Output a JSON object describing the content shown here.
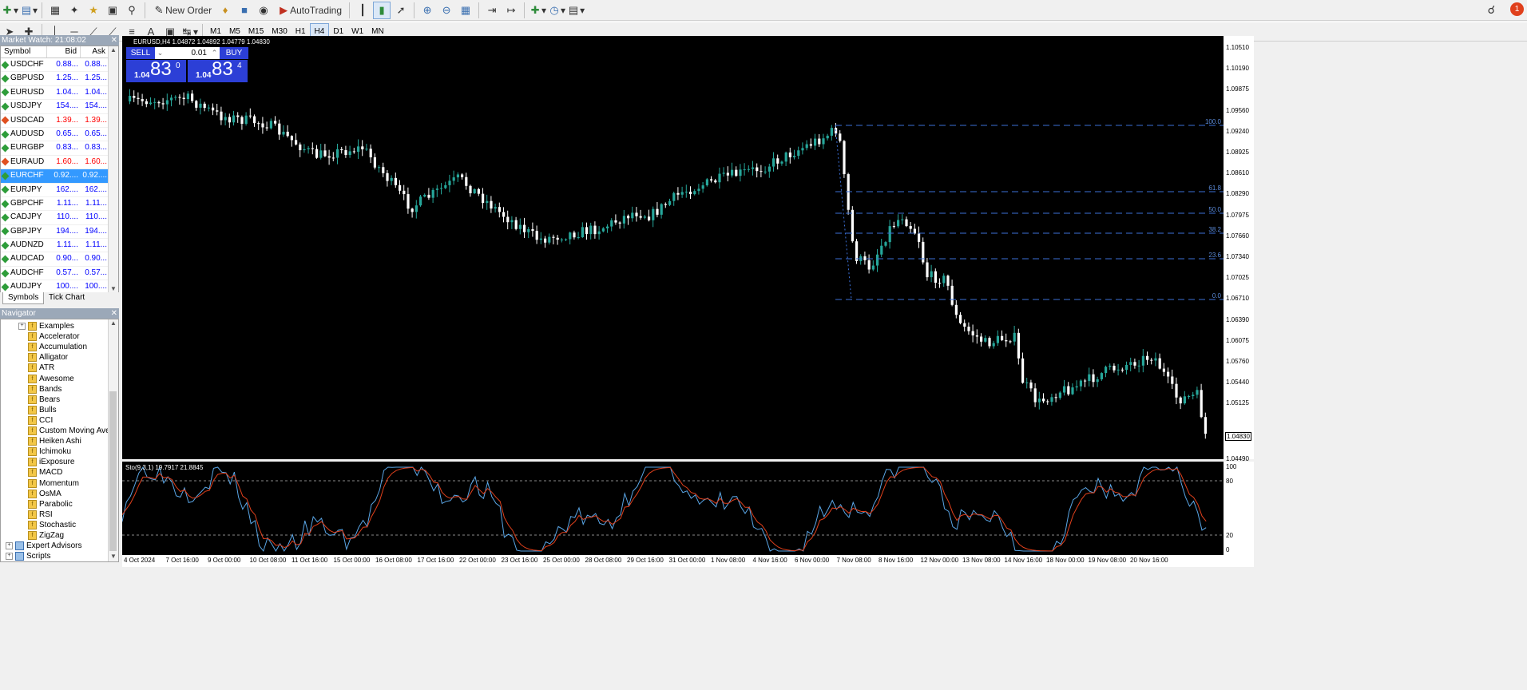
{
  "toolbar": {
    "new_order": "New Order",
    "autotrading": "AutoTrading",
    "notif_count": "1"
  },
  "timeframes": [
    "M1",
    "M5",
    "M15",
    "M30",
    "H1",
    "H4",
    "D1",
    "W1",
    "MN"
  ],
  "active_timeframe": "H4",
  "market_watch": {
    "title": "Market Watch: 21:08:02",
    "col_symbol": "Symbol",
    "col_bid": "Bid",
    "col_ask": "Ask",
    "rows": [
      {
        "symbol": "USDCHF",
        "bid": "0.88...",
        "ask": "0.88...",
        "dir": "up"
      },
      {
        "symbol": "GBPUSD",
        "bid": "1.25...",
        "ask": "1.25...",
        "dir": "up"
      },
      {
        "symbol": "EURUSD",
        "bid": "1.04...",
        "ask": "1.04...",
        "dir": "up"
      },
      {
        "symbol": "USDJPY",
        "bid": "154....",
        "ask": "154....",
        "dir": "up"
      },
      {
        "symbol": "USDCAD",
        "bid": "1.39...",
        "ask": "1.39...",
        "dir": "down"
      },
      {
        "symbol": "AUDUSD",
        "bid": "0.65...",
        "ask": "0.65...",
        "dir": "up"
      },
      {
        "symbol": "EURGBP",
        "bid": "0.83...",
        "ask": "0.83...",
        "dir": "up"
      },
      {
        "symbol": "EURAUD",
        "bid": "1.60...",
        "ask": "1.60...",
        "dir": "down"
      },
      {
        "symbol": "EURCHF",
        "bid": "0.92....",
        "ask": "0.92....",
        "dir": "up",
        "selected": true
      },
      {
        "symbol": "EURJPY",
        "bid": "162....",
        "ask": "162....",
        "dir": "up"
      },
      {
        "symbol": "GBPCHF",
        "bid": "1.11...",
        "ask": "1.11...",
        "dir": "up"
      },
      {
        "symbol": "CADJPY",
        "bid": "110....",
        "ask": "110....",
        "dir": "up"
      },
      {
        "symbol": "GBPJPY",
        "bid": "194....",
        "ask": "194....",
        "dir": "up"
      },
      {
        "symbol": "AUDNZD",
        "bid": "1.11...",
        "ask": "1.11...",
        "dir": "up"
      },
      {
        "symbol": "AUDCAD",
        "bid": "0.90...",
        "ask": "0.90...",
        "dir": "up"
      },
      {
        "symbol": "AUDCHF",
        "bid": "0.57...",
        "ask": "0.57...",
        "dir": "up"
      },
      {
        "symbol": "AUDJPY",
        "bid": "100....",
        "ask": "100....",
        "dir": "up"
      },
      {
        "symbol": "CHFJPY",
        "bid": "174....",
        "ask": "174....",
        "dir": "up"
      }
    ],
    "tab_symbols": "Symbols",
    "tab_tick": "Tick Chart"
  },
  "navigator": {
    "title": "Navigator",
    "indicators": [
      "Examples",
      "Accelerator",
      "Accumulation",
      "Alligator",
      "ATR",
      "Awesome",
      "Bands",
      "Bears",
      "Bulls",
      "CCI",
      "Custom Moving Avera",
      "Heiken Ashi",
      "Ichimoku",
      "iExposure",
      "MACD",
      "Momentum",
      "OsMA",
      "Parabolic",
      "RSI",
      "Stochastic",
      "ZigZag"
    ],
    "expert_advisors": "Expert Advisors",
    "scripts": "Scripts"
  },
  "chart": {
    "title": "EURUSD,H4  1.04872 1.04892 1.04779 1.04830",
    "sell": "SELL",
    "buy": "BUY",
    "lot": "0.01",
    "bid_small": "1.04",
    "bid_big": "83",
    "bid_sup": "0",
    "ask_small": "1.04",
    "ask_big": "83",
    "ask_sup": "4",
    "price_labels": [
      "1.10510",
      "1.10190",
      "1.09875",
      "1.09560",
      "1.09240",
      "1.08925",
      "1.08610",
      "1.08290",
      "1.07975",
      "1.07660",
      "1.07340",
      "1.07025",
      "1.06710",
      "1.06390",
      "1.06075",
      "1.05760",
      "1.05440",
      "1.05125",
      "1.04830",
      "1.04490"
    ],
    "current_price": "1.04830",
    "fib_levels": [
      "100.0",
      "61.8",
      "50.0",
      "38.2",
      "23.6",
      "0.0"
    ],
    "time_labels": [
      "4 Oct 2024",
      "7 Oct 16:00",
      "9 Oct 00:00",
      "10 Oct 08:00",
      "11 Oct 16:00",
      "15 Oct 00:00",
      "16 Oct 08:00",
      "17 Oct 16:00",
      "22 Oct 00:00",
      "23 Oct 16:00",
      "25 Oct 00:00",
      "28 Oct 08:00",
      "29 Oct 16:00",
      "31 Oct 00:00",
      "1 Nov 08:00",
      "4 Nov 16:00",
      "6 Nov 00:00",
      "7 Nov 08:00",
      "8 Nov 16:00",
      "12 Nov 00:00",
      "13 Nov 08:00",
      "14 Nov 16:00",
      "18 Nov 00:00",
      "19 Nov 08:00",
      "20 Nov 16:00"
    ]
  },
  "stochastic": {
    "title": "Sto(9,3,1) 19.7917 21.8845",
    "levels": [
      "100",
      "80",
      "20",
      "0"
    ]
  },
  "colors": {
    "bull": "#26a69a",
    "bear": "#ffffff",
    "main": "#5aa6e6",
    "signal": "#e0401c"
  }
}
